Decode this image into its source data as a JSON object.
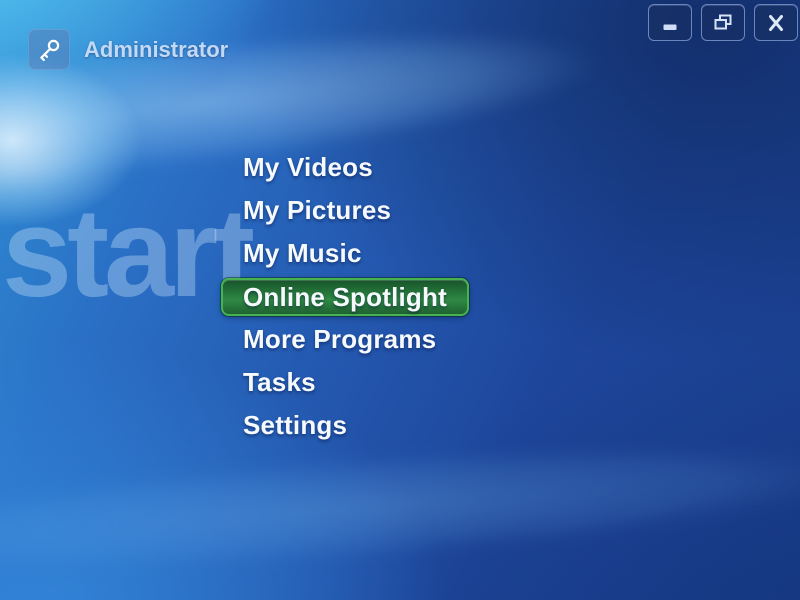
{
  "window": {
    "user": {
      "name": "Administrator",
      "icon": "key-icon"
    },
    "controls": [
      {
        "name": "minimize",
        "icon": "minimize-icon"
      },
      {
        "name": "restore",
        "icon": "restore-icon"
      },
      {
        "name": "close",
        "icon": "close-icon"
      }
    ]
  },
  "background": {
    "watermark_text": "start",
    "colors": {
      "base_blue_light": "#2f8ed2",
      "base_blue_dark": "#1a3f8e",
      "cyan_corner": "#5acdf5",
      "highlight_spot": "#eef9ff"
    }
  },
  "menu": {
    "selected_index": 3,
    "items": [
      {
        "label": "My Videos",
        "selected": false
      },
      {
        "label": "My Pictures",
        "selected": false
      },
      {
        "label": "My Music",
        "selected": false
      },
      {
        "label": "Online Spotlight",
        "selected": true
      },
      {
        "label": "More Programs",
        "selected": false
      },
      {
        "label": "Tasks",
        "selected": false
      },
      {
        "label": "Settings",
        "selected": false
      }
    ],
    "highlight": {
      "border_color": "#46b350",
      "fill_top": "#17542a",
      "fill_mid": "#2f8a45",
      "fill_bottom": "#1f6232"
    }
  }
}
